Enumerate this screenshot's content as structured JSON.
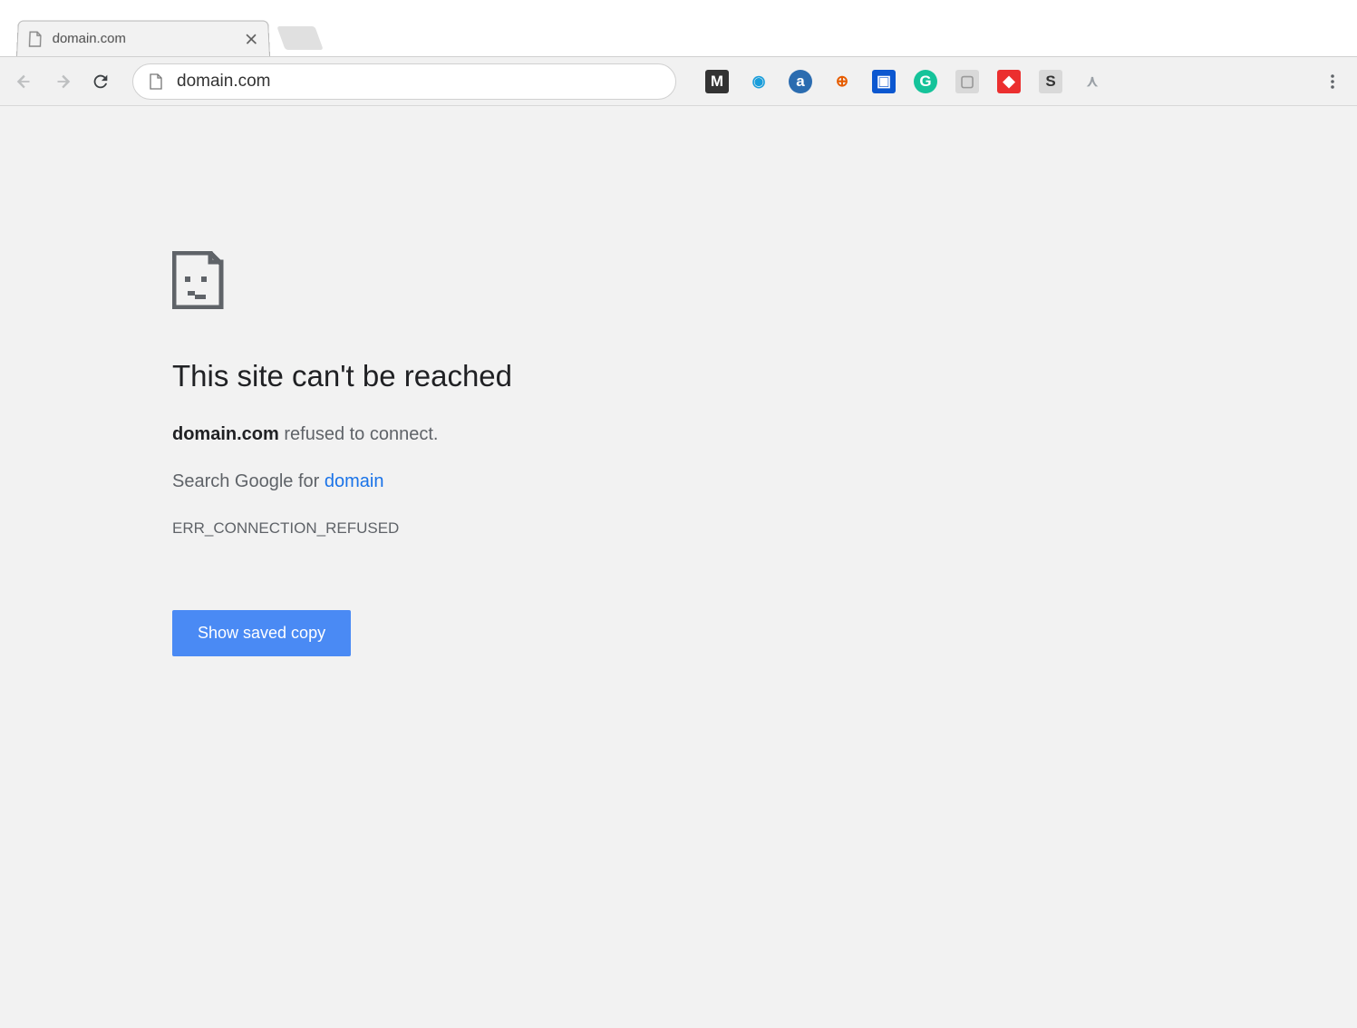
{
  "window": {
    "minimize": "–",
    "maximize": "☐",
    "close": "✕"
  },
  "tab": {
    "title": "domain.com"
  },
  "toolbar": {
    "url": "domain.com"
  },
  "extensions": [
    {
      "name": "mega-extension-icon",
      "bg": "#333",
      "fg": "#fff",
      "letter": "M"
    },
    {
      "name": "circle-blue-extension-icon",
      "bg": "transparent",
      "fg": "#1a9edb",
      "letter": "◉"
    },
    {
      "name": "amazon-extension-icon",
      "bg": "#2b6cb0",
      "fg": "#fff",
      "letter": "a"
    },
    {
      "name": "bitly-extension-icon",
      "bg": "transparent",
      "fg": "#e65c00",
      "letter": "⊕"
    },
    {
      "name": "screenshot-extension-icon",
      "bg": "#0b57d0",
      "fg": "#fff",
      "letter": "▣"
    },
    {
      "name": "grammarly-extension-icon",
      "bg": "#15c39a",
      "fg": "#fff",
      "letter": "G"
    },
    {
      "name": "grey-box-extension-icon",
      "bg": "#d9d9d9",
      "fg": "#999",
      "letter": "▢"
    },
    {
      "name": "red-extension-icon",
      "bg": "#eb2f2f",
      "fg": "#fff",
      "letter": "◆"
    },
    {
      "name": "s-extension-icon",
      "bg": "#d9d9d9",
      "fg": "#333",
      "letter": "S"
    },
    {
      "name": "compass-extension-icon",
      "bg": "transparent",
      "fg": "#9aa0a6",
      "letter": "⋏"
    }
  ],
  "error": {
    "title": "This site can't be reached",
    "host": "domain.com",
    "msg_suffix": " refused to connect.",
    "search_prefix": "Search Google for ",
    "search_term": "domain",
    "code": "ERR_CONNECTION_REFUSED",
    "button": "Show saved copy"
  }
}
